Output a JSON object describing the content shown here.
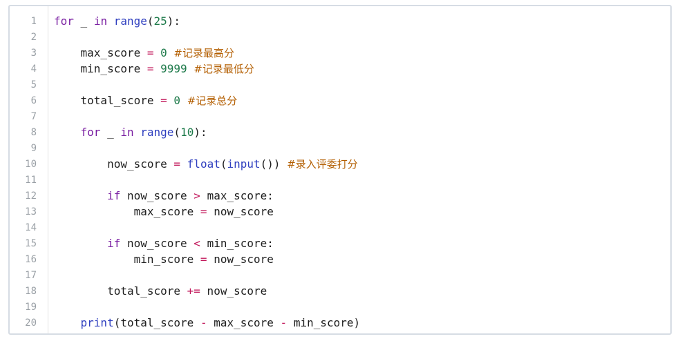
{
  "editor": {
    "line_numbers": [
      "1",
      "2",
      "3",
      "4",
      "5",
      "6",
      "7",
      "8",
      "9",
      "10",
      "11",
      "12",
      "13",
      "14",
      "15",
      "16",
      "17",
      "18",
      "19",
      "20"
    ],
    "lines": [
      {
        "indent": "",
        "tokens": [
          {
            "t": "kw",
            "v": "for"
          },
          {
            "t": "plain",
            "v": " _ "
          },
          {
            "t": "kw",
            "v": "in"
          },
          {
            "t": "plain",
            "v": " "
          },
          {
            "t": "fn",
            "v": "range"
          },
          {
            "t": "plain",
            "v": "("
          },
          {
            "t": "num",
            "v": "25"
          },
          {
            "t": "plain",
            "v": "):"
          }
        ]
      },
      {
        "indent": "",
        "tokens": []
      },
      {
        "indent": "    ",
        "tokens": [
          {
            "t": "plain",
            "v": "max_score "
          },
          {
            "t": "op",
            "v": "="
          },
          {
            "t": "plain",
            "v": " "
          },
          {
            "t": "num",
            "v": "0"
          },
          {
            "t": "plain",
            "v": " "
          },
          {
            "t": "cm",
            "v": "#记录最高分"
          }
        ]
      },
      {
        "indent": "    ",
        "tokens": [
          {
            "t": "plain",
            "v": "min_score "
          },
          {
            "t": "op",
            "v": "="
          },
          {
            "t": "plain",
            "v": " "
          },
          {
            "t": "num",
            "v": "9999"
          },
          {
            "t": "plain",
            "v": " "
          },
          {
            "t": "cm",
            "v": "#记录最低分"
          }
        ]
      },
      {
        "indent": "",
        "tokens": []
      },
      {
        "indent": "    ",
        "tokens": [
          {
            "t": "plain",
            "v": "total_score "
          },
          {
            "t": "op",
            "v": "="
          },
          {
            "t": "plain",
            "v": " "
          },
          {
            "t": "num",
            "v": "0"
          },
          {
            "t": "plain",
            "v": " "
          },
          {
            "t": "cm",
            "v": "#记录总分"
          }
        ]
      },
      {
        "indent": "",
        "tokens": []
      },
      {
        "indent": "    ",
        "tokens": [
          {
            "t": "kw",
            "v": "for"
          },
          {
            "t": "plain",
            "v": " _ "
          },
          {
            "t": "kw",
            "v": "in"
          },
          {
            "t": "plain",
            "v": " "
          },
          {
            "t": "fn",
            "v": "range"
          },
          {
            "t": "plain",
            "v": "("
          },
          {
            "t": "num",
            "v": "10"
          },
          {
            "t": "plain",
            "v": "):"
          }
        ]
      },
      {
        "indent": "",
        "tokens": []
      },
      {
        "indent": "        ",
        "tokens": [
          {
            "t": "plain",
            "v": "now_score "
          },
          {
            "t": "op",
            "v": "="
          },
          {
            "t": "plain",
            "v": " "
          },
          {
            "t": "fn",
            "v": "float"
          },
          {
            "t": "plain",
            "v": "("
          },
          {
            "t": "fn",
            "v": "input"
          },
          {
            "t": "plain",
            "v": "()) "
          },
          {
            "t": "cm",
            "v": "#录入评委打分"
          }
        ]
      },
      {
        "indent": "",
        "tokens": []
      },
      {
        "indent": "        ",
        "tokens": [
          {
            "t": "kw",
            "v": "if"
          },
          {
            "t": "plain",
            "v": " now_score "
          },
          {
            "t": "op",
            "v": ">"
          },
          {
            "t": "plain",
            "v": " max_score:"
          }
        ]
      },
      {
        "indent": "            ",
        "tokens": [
          {
            "t": "plain",
            "v": "max_score "
          },
          {
            "t": "op",
            "v": "="
          },
          {
            "t": "plain",
            "v": " now_score"
          }
        ]
      },
      {
        "indent": "",
        "tokens": []
      },
      {
        "indent": "        ",
        "tokens": [
          {
            "t": "kw",
            "v": "if"
          },
          {
            "t": "plain",
            "v": " now_score "
          },
          {
            "t": "op",
            "v": "<"
          },
          {
            "t": "plain",
            "v": " min_score:"
          }
        ]
      },
      {
        "indent": "            ",
        "tokens": [
          {
            "t": "plain",
            "v": "min_score "
          },
          {
            "t": "op",
            "v": "="
          },
          {
            "t": "plain",
            "v": " now_score"
          }
        ]
      },
      {
        "indent": "",
        "tokens": []
      },
      {
        "indent": "        ",
        "tokens": [
          {
            "t": "plain",
            "v": "total_score "
          },
          {
            "t": "op",
            "v": "+="
          },
          {
            "t": "plain",
            "v": " now_score"
          }
        ]
      },
      {
        "indent": "",
        "tokens": []
      },
      {
        "indent": "    ",
        "tokens": [
          {
            "t": "fn",
            "v": "print"
          },
          {
            "t": "plain",
            "v": "(total_score "
          },
          {
            "t": "op",
            "v": "-"
          },
          {
            "t": "plain",
            "v": " max_score "
          },
          {
            "t": "op",
            "v": "-"
          },
          {
            "t": "plain",
            "v": " min_score)"
          }
        ]
      }
    ]
  },
  "colors": {
    "keyword": "#7a1fa2",
    "function": "#2f3fbf",
    "number": "#1d7a4a",
    "operator": "#c2185b",
    "comment": "#b35e00",
    "line_number": "#9aa0a6",
    "border": "#d6dce4"
  }
}
